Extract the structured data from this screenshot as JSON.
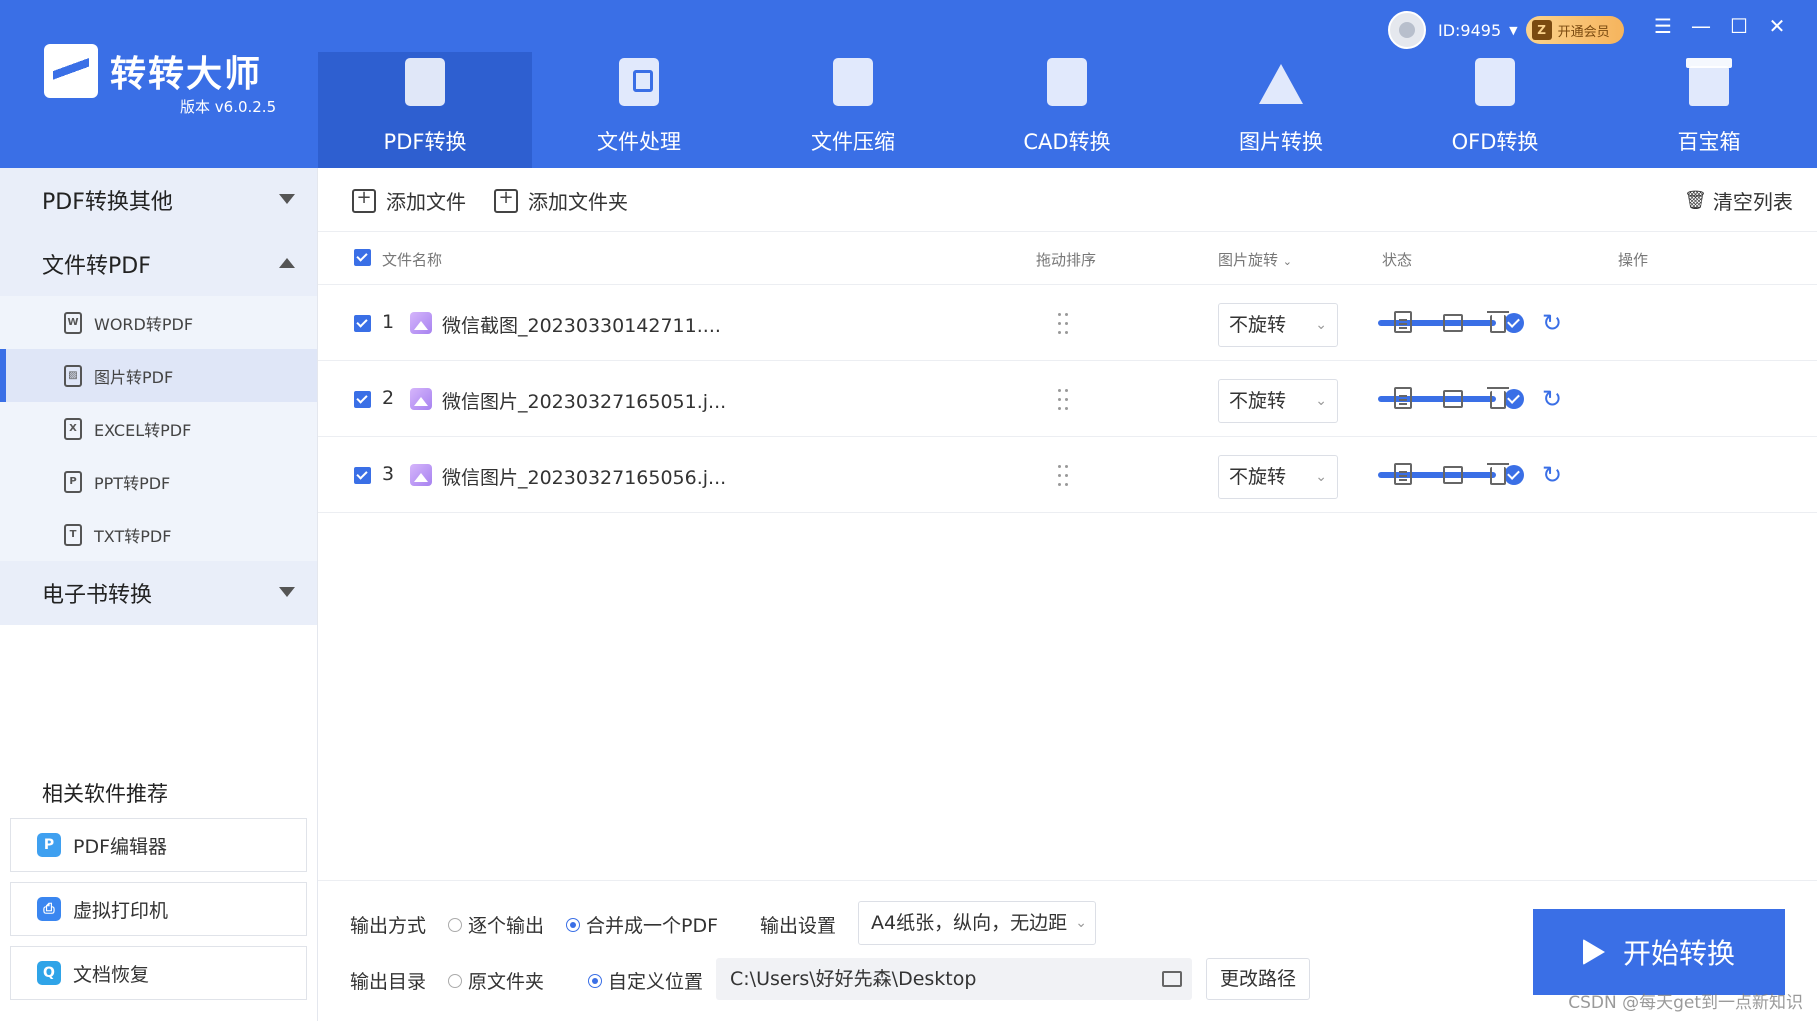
{
  "app": {
    "name": "转转大师",
    "version": "版本 v6.0.2.5"
  },
  "user": {
    "id": "ID:9495",
    "vip_label": "开通会员"
  },
  "window_controls": [
    "menu-icon",
    "minimize-icon",
    "maximize-icon",
    "close-icon"
  ],
  "nav": [
    {
      "label": "PDF转换",
      "icon": "pdf-convert-icon",
      "active": true
    },
    {
      "label": "文件处理",
      "icon": "file-process-icon",
      "active": false
    },
    {
      "label": "文件压缩",
      "icon": "zip-icon",
      "active": false
    },
    {
      "label": "CAD转换",
      "icon": "cad-icon",
      "active": false
    },
    {
      "label": "图片转换",
      "icon": "image-icon",
      "active": false
    },
    {
      "label": "OFD转换",
      "icon": "ofd-icon",
      "active": false
    },
    {
      "label": "百宝箱",
      "icon": "toolbox-icon",
      "active": false
    }
  ],
  "sidebar": {
    "groups": [
      {
        "label": "PDF转换其他",
        "expanded": false
      },
      {
        "label": "文件转PDF",
        "expanded": true
      },
      {
        "label": "电子书转换",
        "expanded": false
      }
    ],
    "items": [
      {
        "label": "WORD转PDF",
        "icon": "W"
      },
      {
        "label": "图片转PDF",
        "icon": "▨",
        "active": true
      },
      {
        "label": "EXCEL转PDF",
        "icon": "X"
      },
      {
        "label": "PPT转PDF",
        "icon": "P"
      },
      {
        "label": "TXT转PDF",
        "icon": "T"
      }
    ],
    "recommend_title": "相关软件推荐",
    "recommend": [
      {
        "label": "PDF编辑器",
        "color": "#3fa0f0"
      },
      {
        "label": "虚拟打印机",
        "color": "#3a86f0"
      },
      {
        "label": "文档恢复",
        "color": "#2fa4e8"
      }
    ]
  },
  "toolbar": {
    "add_file": "添加文件",
    "add_folder": "添加文件夹",
    "clear_list": "清空列表"
  },
  "table": {
    "headers": {
      "name": "文件名称",
      "drag": "拖动排序",
      "rotate": "图片旋转",
      "status": "状态",
      "action": "操作"
    },
    "rows": [
      {
        "index": "1",
        "name": "微信截图_20230330142711....",
        "rotate": "不旋转",
        "progress": 1.0
      },
      {
        "index": "2",
        "name": "微信图片_20230327165051.j...",
        "rotate": "不旋转",
        "progress": 1.0
      },
      {
        "index": "3",
        "name": "微信图片_20230327165056.j...",
        "rotate": "不旋转",
        "progress": 1.0
      }
    ]
  },
  "output": {
    "mode_label": "输出方式",
    "mode_single": "逐个输出",
    "mode_merge": "合并成一个PDF",
    "settings_label": "输出设置",
    "settings_value": "A4纸张，纵向，无边距",
    "dir_label": "输出目录",
    "dir_original": "原文件夹",
    "dir_custom": "自定义位置",
    "path": "C:\\Users\\好好先森\\Desktop",
    "change_path": "更改路径",
    "start": "开始转换"
  },
  "watermark": "CSDN @每天get到一点新知识",
  "colors": {
    "accent": "#3a6fe6",
    "header_active": "#2e5fd0",
    "sidebar_bg": "#e9eef9"
  }
}
